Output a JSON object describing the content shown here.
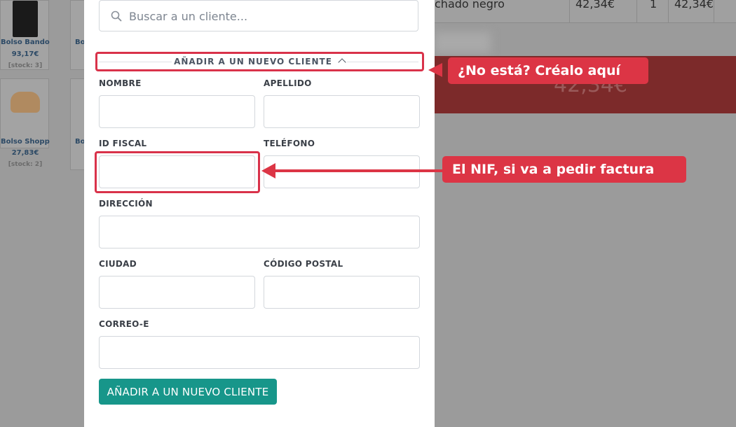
{
  "products": [
    {
      "name": "Bolso Bandol...",
      "price": "93,17€",
      "stock": "[stock: 3]"
    },
    {
      "name": "Bolso Shoppe...",
      "price": "27,83€",
      "stock": "[stock: 2]"
    }
  ],
  "product_stub_label": "Bo",
  "ticket": {
    "item_name": "chado negro",
    "unit_price": "42,34€",
    "qty": "1",
    "line_total": "42,34€",
    "total": "42,34€"
  },
  "search": {
    "placeholder": "Buscar a un cliente..."
  },
  "new_client": {
    "section_toggle": "AÑADIR A UN NUEVO CLIENTE",
    "fields": {
      "first_name": "NOMBRE",
      "last_name": "APELLIDO",
      "tax_id": "ID FISCAL",
      "phone": "TELÉFONO",
      "address": "DIRECCIÓN",
      "city": "CIUDAD",
      "postal_code": "CÓDIGO POSTAL",
      "email": "CORREO-E"
    },
    "submit_label": "AÑADIR A UN NUEVO CLIENTE"
  },
  "annotations": {
    "create_here": "¿No está? Créalo aquí",
    "nif_hint": "El NIF, si va a pedir factura"
  },
  "colors": {
    "accent": "#17968a",
    "annotation": "#dc3545",
    "total_bar": "#7c2a2a"
  }
}
